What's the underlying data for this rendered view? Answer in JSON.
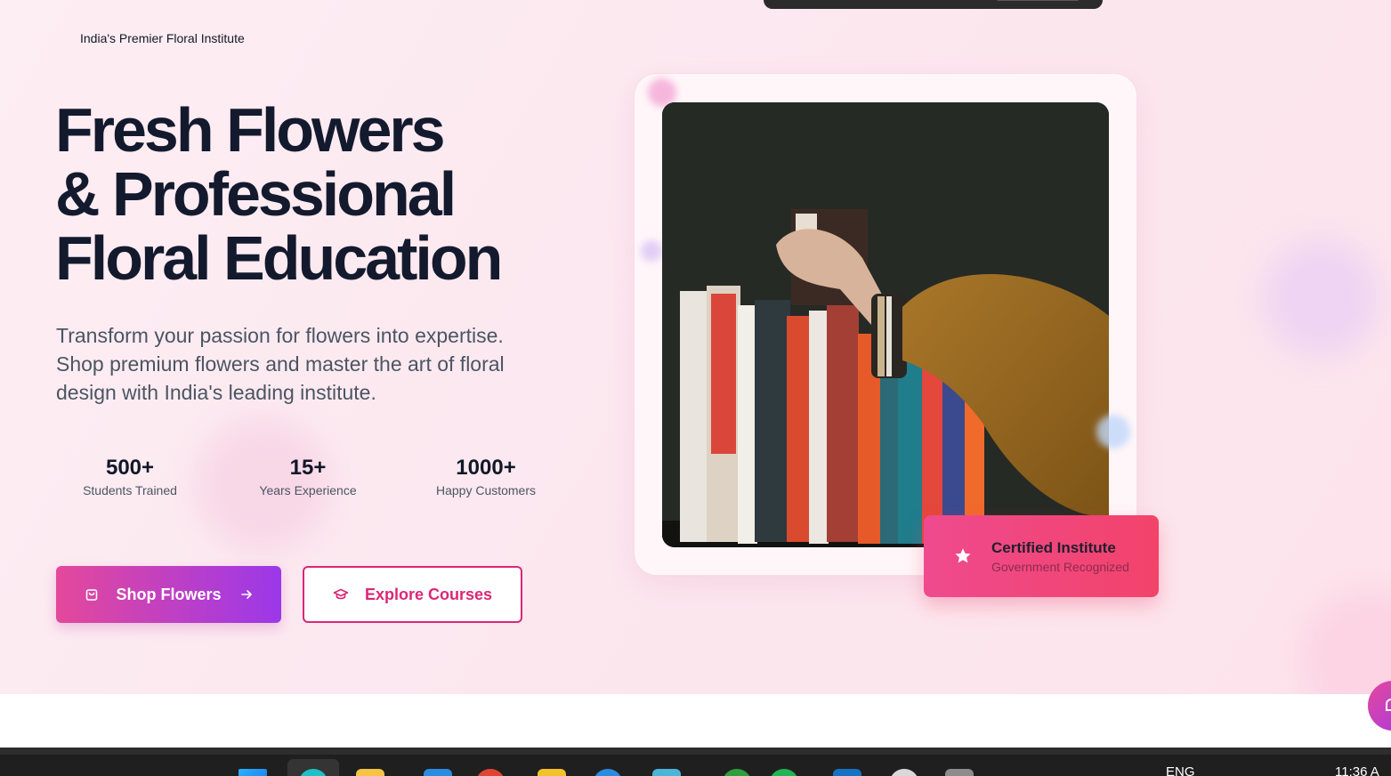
{
  "hero": {
    "tagline": "India's Premier Floral Institute",
    "headline": {
      "line1": "Fresh Flowers",
      "line2": "& Professional",
      "line3": "Floral Education"
    },
    "description": "Transform your passion for flowers into expertise. Shop premium flowers and master the art of floral design with India's leading institute."
  },
  "stats": [
    {
      "value": "500+",
      "label": "Students Trained"
    },
    {
      "value": "15+",
      "label": "Years Experience"
    },
    {
      "value": "1000+",
      "label": "Happy Customers"
    }
  ],
  "buttons": {
    "shop": {
      "label": "Shop Flowers",
      "icon": "shopping-bag-icon",
      "trailing_icon": "arrow-right-icon"
    },
    "courses": {
      "label": "Explore Courses",
      "icon": "graduation-cap-icon"
    }
  },
  "badge": {
    "title": "Certified Institute",
    "subtitle": "Government Recognized",
    "icon": "star-icon"
  },
  "taskbar": {
    "language": "ENG",
    "time": "11:36 A"
  },
  "colors": {
    "brand_pink": "#db2777",
    "gradient_start": "#e5489b",
    "gradient_end": "#9b38e9",
    "badge_start": "#ef4a8e",
    "badge_end": "#f2436a",
    "heading": "#141a2e"
  }
}
